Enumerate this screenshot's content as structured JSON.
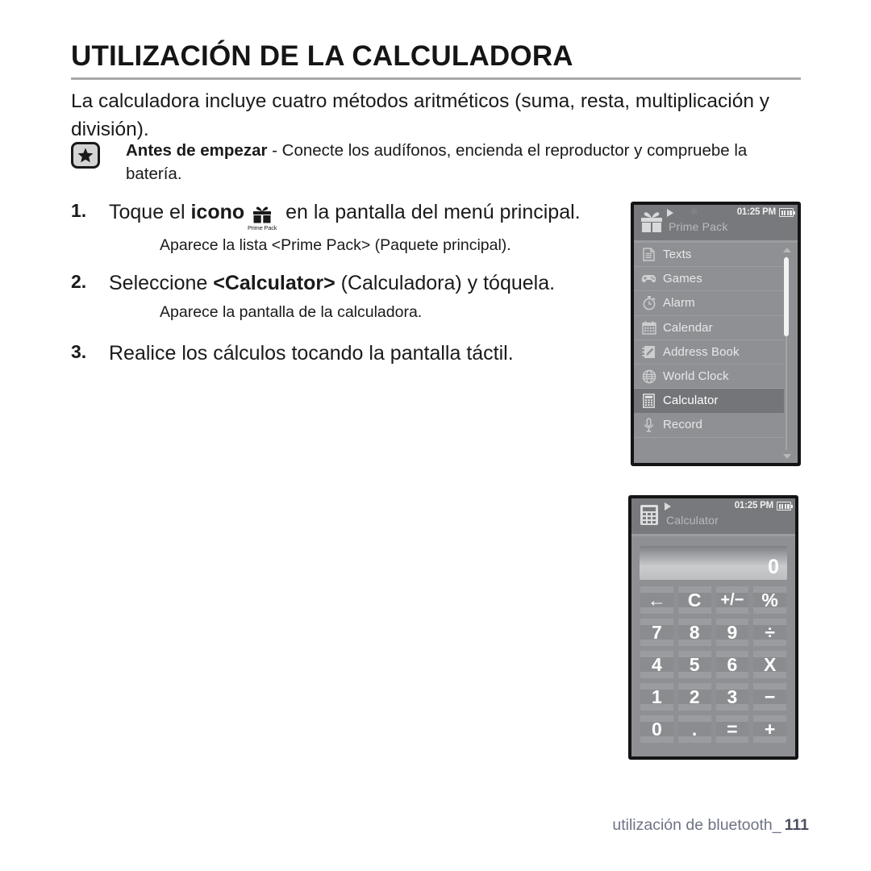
{
  "page": {
    "title": "UTILIZACIÓN DE LA CALCULADORA",
    "intro": "La calculadora incluye cuatro métodos aritméticos (suma, resta, multiplicación y división).",
    "footer_text": "utilización de bluetooth_",
    "page_number": "111"
  },
  "note": {
    "icon": "star-icon",
    "label_bold": "Antes de empezar",
    "label_rest": " - Conecte los audífonos, encienda el reproductor y compruebe la batería."
  },
  "steps": [
    {
      "number": "1.",
      "text_before": "Toque el ",
      "bold": "icono",
      "inline_icon": "prime-pack-icon",
      "inline_icon_caption": "Prime Pack",
      "text_after": " en la pantalla del menú principal.",
      "sub": "Aparece la lista <Prime Pack> (Paquete principal)."
    },
    {
      "number": "2.",
      "text_before": "Seleccione ",
      "bold": "<Calculator>",
      "text_after": " (Calculadora) y tóquela.",
      "sub": "Aparece la pantalla de la calculadora."
    },
    {
      "number": "3.",
      "text_before": "Realice los cálculos tocando la pantalla táctil.",
      "bold": "",
      "text_after": "",
      "sub": ""
    }
  ],
  "device_menu": {
    "statusbar": {
      "app_icon": "gift-box-icon",
      "app_title": "Prime Pack",
      "play_icon": "play-icon",
      "bluetooth_icon": "bluetooth-icon",
      "time": "01:25 PM",
      "battery_icon": "battery-full-icon"
    },
    "items": [
      {
        "label": "Texts",
        "icon": "document-icon",
        "selected": false
      },
      {
        "label": "Games",
        "icon": "gamepad-icon",
        "selected": false
      },
      {
        "label": "Alarm",
        "icon": "stopwatch-icon",
        "selected": false
      },
      {
        "label": "Calendar",
        "icon": "calendar-icon",
        "selected": false
      },
      {
        "label": "Address Book",
        "icon": "address-book-icon",
        "selected": false
      },
      {
        "label": "World Clock",
        "icon": "globe-icon",
        "selected": false
      },
      {
        "label": "Calculator",
        "icon": "calculator-icon",
        "selected": true
      },
      {
        "label": "Record",
        "icon": "microphone-icon",
        "selected": false
      }
    ],
    "scrollbar": {
      "up_arrow": "chevron-up-icon",
      "down_arrow": "chevron-down-icon"
    },
    "back_button_icon": "back-arrow-icon"
  },
  "device_calc": {
    "statusbar": {
      "app_icon": "calculator-icon",
      "app_title": "Calculator",
      "play_icon": "play-icon",
      "time": "01:25 PM",
      "battery_icon": "battery-full-icon"
    },
    "display_value": "0",
    "keys": [
      {
        "label": "←",
        "name": "backspace-key",
        "small": false
      },
      {
        "label": "C",
        "name": "clear-key",
        "small": false
      },
      {
        "label": "+/−",
        "name": "sign-toggle-key",
        "small": true
      },
      {
        "label": "%",
        "name": "percent-key",
        "small": false
      },
      {
        "label": "7",
        "name": "digit-7-key",
        "small": false
      },
      {
        "label": "8",
        "name": "digit-8-key",
        "small": false
      },
      {
        "label": "9",
        "name": "digit-9-key",
        "small": false
      },
      {
        "label": "÷",
        "name": "divide-key",
        "small": false
      },
      {
        "label": "4",
        "name": "digit-4-key",
        "small": false
      },
      {
        "label": "5",
        "name": "digit-5-key",
        "small": false
      },
      {
        "label": "6",
        "name": "digit-6-key",
        "small": false
      },
      {
        "label": "X",
        "name": "multiply-key",
        "small": false
      },
      {
        "label": "1",
        "name": "digit-1-key",
        "small": false
      },
      {
        "label": "2",
        "name": "digit-2-key",
        "small": false
      },
      {
        "label": "3",
        "name": "digit-3-key",
        "small": false
      },
      {
        "label": "−",
        "name": "subtract-key",
        "small": false
      },
      {
        "label": "0",
        "name": "digit-0-key",
        "small": false
      },
      {
        "label": ".",
        "name": "decimal-point-key",
        "small": false
      },
      {
        "label": "=",
        "name": "equals-key",
        "small": false
      },
      {
        "label": "+",
        "name": "add-key",
        "small": false
      }
    ],
    "back_button_icon": "back-arrow-icon"
  },
  "colors": {
    "device_bg": "#8e9093",
    "device_statusbar": "#77797c",
    "selected_row": "#737578",
    "footer_text": "#6f7385",
    "rule": "#a9a9ac"
  }
}
